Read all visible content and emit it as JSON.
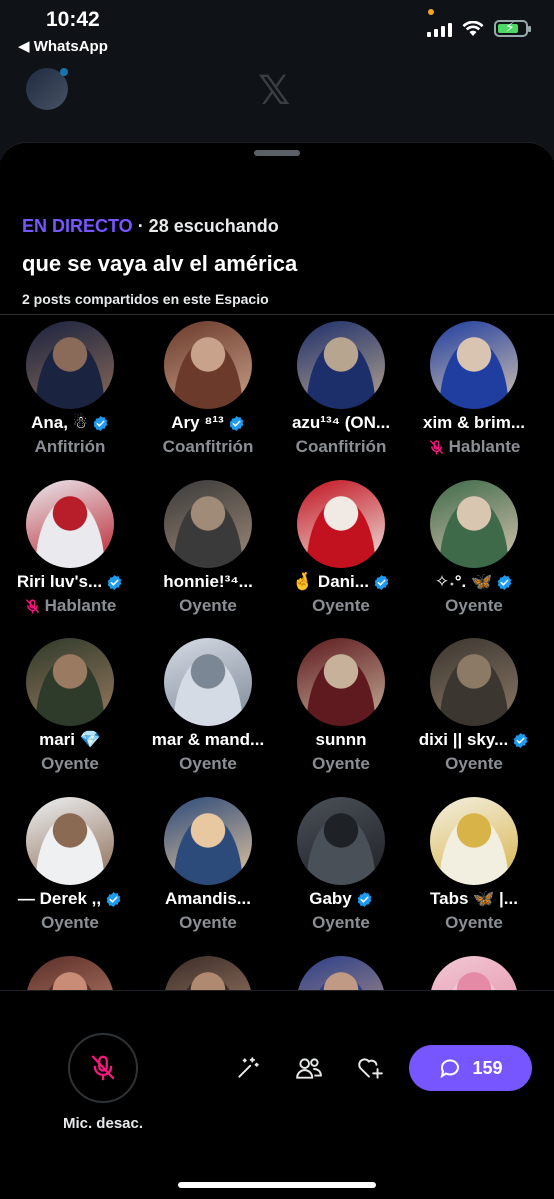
{
  "status_bar": {
    "time": "10:42",
    "back_app": "◀ WhatsApp"
  },
  "backdrop": {
    "logo": "𝕏"
  },
  "space": {
    "live_label": "EN DIRECTO",
    "listeners": " · 28 escuchando",
    "title": "que se vaya alv el américa",
    "subtitle": "2 posts compartidos en este Espacio"
  },
  "participants": [
    {
      "name": "Ana, ☃",
      "verified": true,
      "role": "Anfitrión",
      "muted": false,
      "colors": [
        "#1a2340",
        "#8a6a58"
      ]
    },
    {
      "name": "Ary ⁸¹³",
      "verified": true,
      "role": "Coanfitrión",
      "muted": false,
      "colors": [
        "#6b3a2a",
        "#c9a28b"
      ]
    },
    {
      "name": "azu¹³⁴ (ON...",
      "verified": false,
      "role": "Coanfitrión",
      "muted": false,
      "colors": [
        "#1d2f6b",
        "#b8a590"
      ]
    },
    {
      "name": "xim & brim...",
      "verified": false,
      "role": "Hablante",
      "muted": true,
      "colors": [
        "#1f3ea0",
        "#d8c4b0"
      ]
    },
    {
      "name": "Riri luv's...",
      "verified": true,
      "role": "Hablante",
      "muted": true,
      "colors": [
        "#e9e9ee",
        "#b81e2a"
      ]
    },
    {
      "name": "honnie!³⁴...",
      "verified": false,
      "role": "Oyente",
      "muted": false,
      "colors": [
        "#3a3a3a",
        "#a08a78"
      ]
    },
    {
      "name": "🤞 Dani...",
      "verified": true,
      "role": "Oyente",
      "muted": false,
      "colors": [
        "#c2121f",
        "#f0e9e4"
      ]
    },
    {
      "name": "✧˖°. 🦋",
      "verified": true,
      "role": "Oyente",
      "muted": false,
      "colors": [
        "#3e6a4a",
        "#d9c6b1"
      ]
    },
    {
      "name": "mari 💎",
      "verified": false,
      "role": "Oyente",
      "muted": false,
      "colors": [
        "#2e3a2a",
        "#9a7a60"
      ]
    },
    {
      "name": "mar & mand...",
      "verified": false,
      "role": "Oyente",
      "muted": false,
      "colors": [
        "#d5dbe4",
        "#7c8796"
      ]
    },
    {
      "name": "sunnn",
      "verified": false,
      "role": "Oyente",
      "muted": false,
      "colors": [
        "#5e1a1f",
        "#c7b19a"
      ]
    },
    {
      "name": "dixi || sky...",
      "verified": true,
      "role": "Oyente",
      "muted": false,
      "colors": [
        "#3b3630",
        "#8c7a66"
      ]
    },
    {
      "name": "— Derek ,,",
      "verified": true,
      "role": "Oyente",
      "muted": false,
      "colors": [
        "#eef0f2",
        "#8a6a52"
      ]
    },
    {
      "name": "Amandis...",
      "verified": false,
      "role": "Oyente",
      "muted": false,
      "colors": [
        "#2c4a7a",
        "#e8c8a0"
      ]
    },
    {
      "name": "Gaby",
      "verified": true,
      "role": "Oyente",
      "muted": false,
      "colors": [
        "#4a5057",
        "#1e2126"
      ]
    },
    {
      "name": "Tabs 🦋 |...",
      "verified": false,
      "role": "Oyente",
      "muted": false,
      "colors": [
        "#f3efe0",
        "#d8b348"
      ]
    },
    {
      "name": "",
      "verified": false,
      "role": "",
      "muted": false,
      "colors": [
        "#5a2e28",
        "#c98c76"
      ]
    },
    {
      "name": "",
      "verified": false,
      "role": "",
      "muted": false,
      "colors": [
        "#3a2c28",
        "#b08a70"
      ]
    },
    {
      "name": "",
      "verified": false,
      "role": "",
      "muted": false,
      "colors": [
        "#2a3f8a",
        "#c09a84"
      ]
    },
    {
      "name": "",
      "verified": false,
      "role": "",
      "muted": false,
      "colors": [
        "#f0c8d4",
        "#e58aa6"
      ]
    }
  ],
  "bottom_bar": {
    "mic_label": "Mic. desac.",
    "comment_count": "159"
  },
  "colors": {
    "accent": "#7856ff",
    "verified": "#1d9bf0",
    "muted": "#f91880",
    "secondary_text": "#8b8f94"
  },
  "icons": [
    "mic-off-icon",
    "sparkle-wand-icon",
    "people-icon",
    "heart-plus-icon",
    "comment-icon",
    "verified-badge-icon"
  ]
}
